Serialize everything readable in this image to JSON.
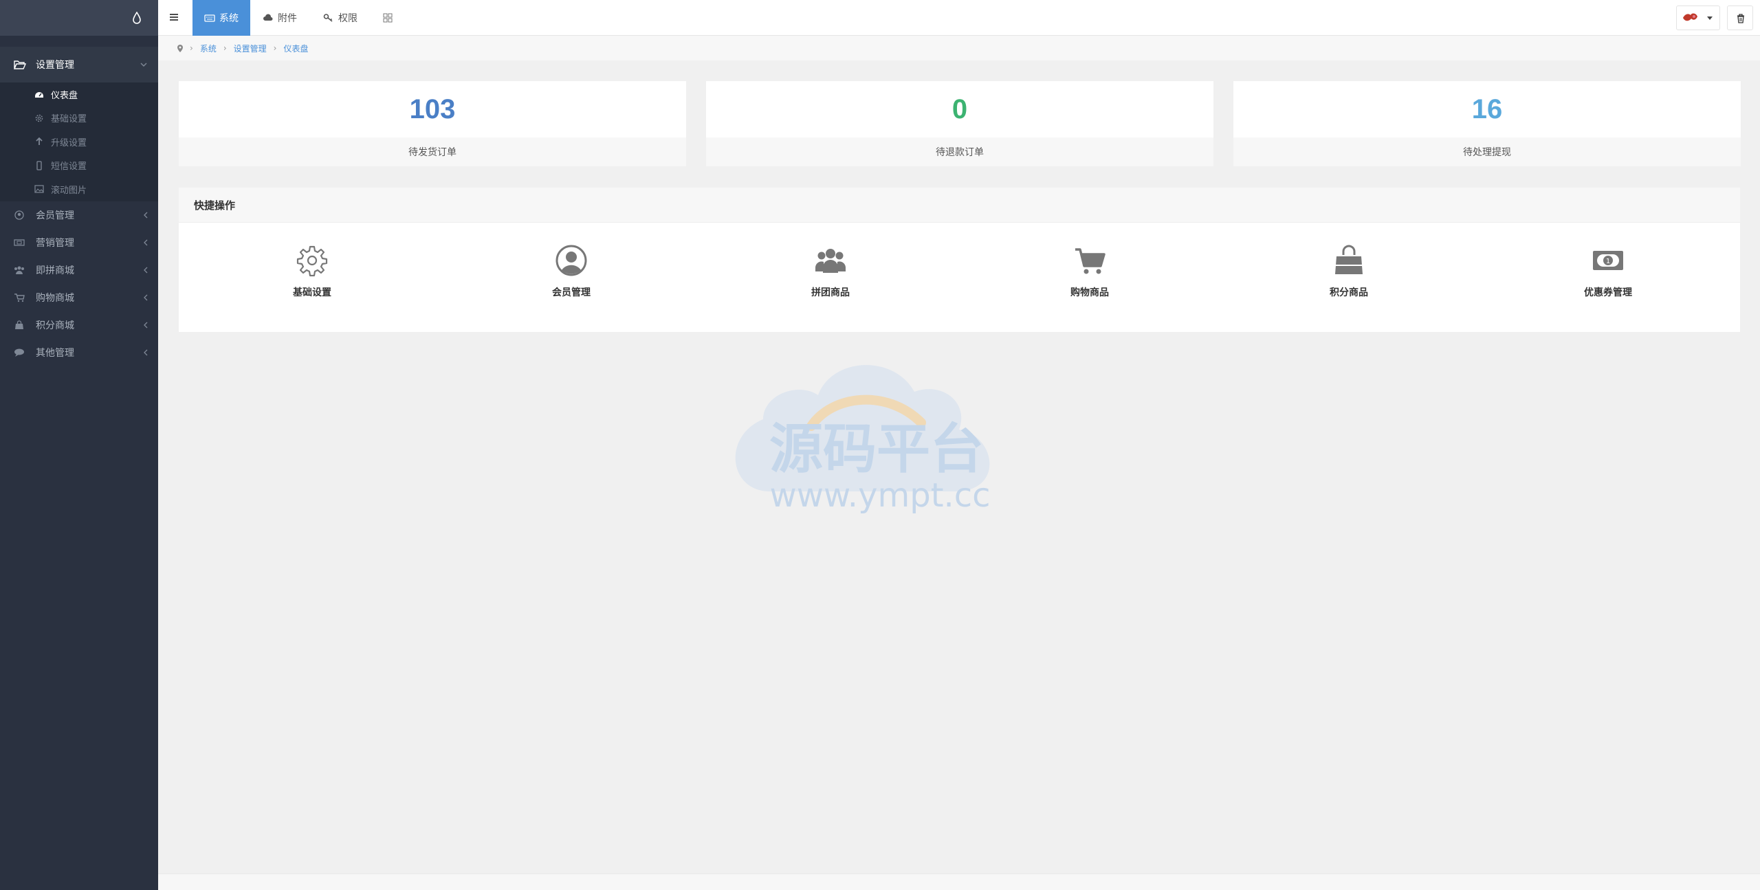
{
  "sidebar": {
    "groups": [
      {
        "label": "设置管理",
        "icon": "folder-open-icon",
        "expanded": true
      },
      {
        "label": "会员管理",
        "icon": "user-circle-icon"
      },
      {
        "label": "营销管理",
        "icon": "ticket-icon"
      },
      {
        "label": "即拼商城",
        "icon": "users-icon"
      },
      {
        "label": "购物商城",
        "icon": "cart-icon"
      },
      {
        "label": "积分商城",
        "icon": "bag-icon"
      },
      {
        "label": "其他管理",
        "icon": "chat-icon"
      }
    ],
    "sub_items": [
      {
        "label": "仪表盘",
        "icon": "dashboard-icon",
        "active": true
      },
      {
        "label": "基础设置",
        "icon": "gear-icon"
      },
      {
        "label": "升级设置",
        "icon": "arrow-up-icon"
      },
      {
        "label": "短信设置",
        "icon": "mobile-icon"
      },
      {
        "label": "滚动图片",
        "icon": "image-icon"
      }
    ]
  },
  "topbar": {
    "tabs": [
      {
        "label": "系统",
        "icon": "keyboard-icon",
        "active": true
      },
      {
        "label": "附件",
        "icon": "cloud-icon"
      },
      {
        "label": "权限",
        "icon": "key-icon"
      },
      {
        "label": "",
        "icon": "grid-icon"
      }
    ]
  },
  "breadcrumb": [
    "系统",
    "设置管理",
    "仪表盘"
  ],
  "stats": [
    {
      "value": "103",
      "label": "待发货订单",
      "color": "#4a7fc6"
    },
    {
      "value": "0",
      "label": "待退款订单",
      "color": "#3cb371"
    },
    {
      "value": "16",
      "label": "待处理提现",
      "color": "#5aa8db"
    }
  ],
  "quick": {
    "title": "快捷操作",
    "items": [
      {
        "label": "基础设置",
        "icon": "gear-icon"
      },
      {
        "label": "会员管理",
        "icon": "user-circle-icon"
      },
      {
        "label": "拼团商品",
        "icon": "users-icon"
      },
      {
        "label": "购物商品",
        "icon": "cart-icon"
      },
      {
        "label": "积分商品",
        "icon": "bag-icon"
      },
      {
        "label": "优惠券管理",
        "icon": "money-icon"
      }
    ]
  },
  "watermark": {
    "title": "源码平台",
    "url": "www.ympt.cc"
  },
  "colors": {
    "sidebar": "#2a3140",
    "accent": "#4a90d9",
    "background": "#f0f0f0"
  }
}
